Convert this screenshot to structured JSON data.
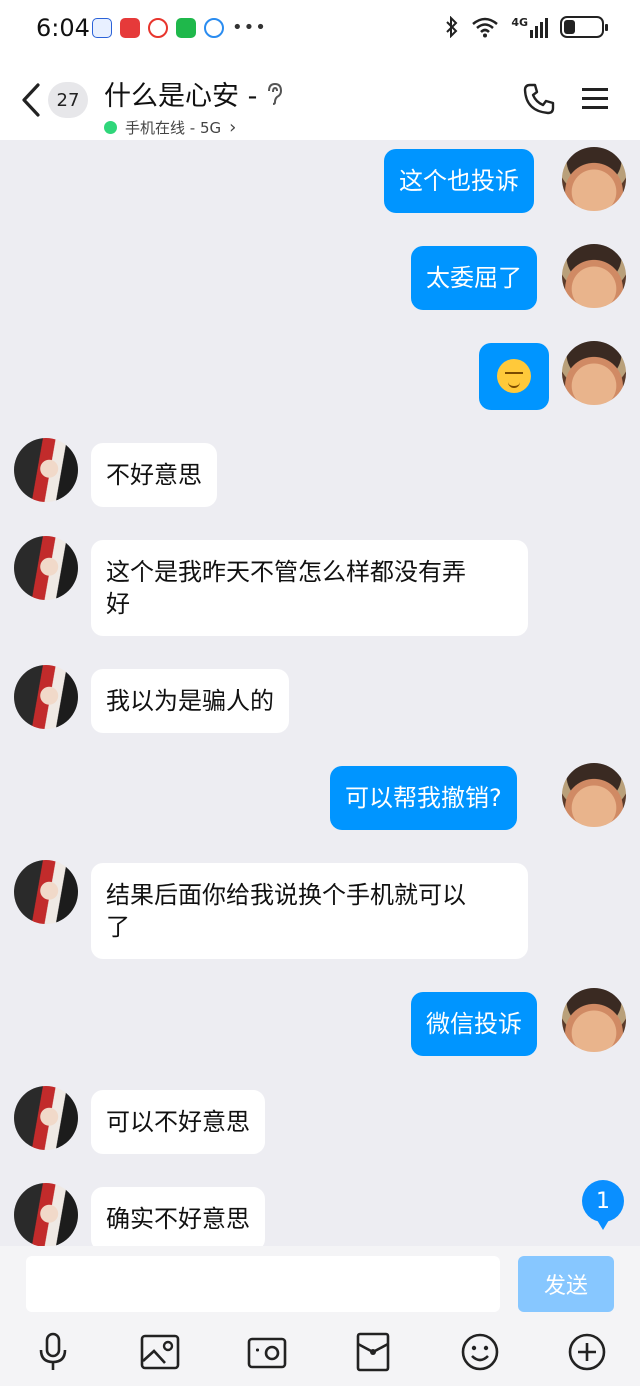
{
  "status_bar": {
    "time": "6:04",
    "network": "4G",
    "battery_level": 0.3
  },
  "header": {
    "unread_count": "27",
    "title": "什么是心安 -",
    "presence": "手机在线 - 5G",
    "presence_chevron": "›",
    "online_color": "#2fd67a"
  },
  "messages": [
    {
      "side": "sent",
      "text": "这个也投诉"
    },
    {
      "side": "sent",
      "text": "太委屈了"
    },
    {
      "side": "sent",
      "emoji": "grinning-squint-emoji"
    },
    {
      "side": "recv",
      "text": "不好意思"
    },
    {
      "side": "recv",
      "text": "这个是我昨天不管怎么样都没有弄好"
    },
    {
      "side": "recv",
      "text": "我以为是骗人的"
    },
    {
      "side": "sent",
      "text": "可以帮我撤销?"
    },
    {
      "side": "recv",
      "text": "结果后面你给我说换个手机就可以了"
    },
    {
      "side": "sent",
      "text": "微信投诉"
    },
    {
      "side": "recv",
      "text": "可以不好意思"
    },
    {
      "side": "recv",
      "text": "确实不好意思"
    }
  ],
  "msg_lines": {
    "m4_line1": "这个是我昨天不管怎么样都没有弄",
    "m4_line2": "好",
    "m7_line1": "结果后面你给我说换个手机就可以",
    "m7_line2": "了"
  },
  "new_message_badge": "1",
  "composer": {
    "input_value": "",
    "send_label": "发送"
  },
  "toolbar_icons": [
    "microphone-icon",
    "image-icon",
    "camera-icon",
    "red-packet-icon",
    "emoji-icon",
    "plus-icon"
  ],
  "colors": {
    "sent_bubble": "#0095ff",
    "recv_bubble": "#ffffff",
    "background": "#ededf2",
    "send_button": "#87c7ff"
  }
}
